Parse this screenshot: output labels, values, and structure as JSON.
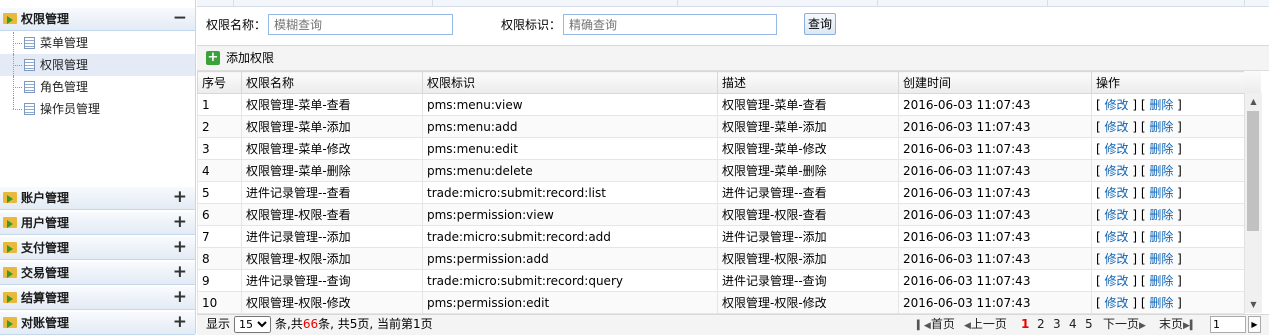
{
  "sidebar": {
    "sections": [
      {
        "label": "权限管理",
        "toggle": "−"
      },
      {
        "label": "账户管理",
        "toggle": "+"
      },
      {
        "label": "用户管理",
        "toggle": "+"
      },
      {
        "label": "支付管理",
        "toggle": "+"
      },
      {
        "label": "交易管理",
        "toggle": "+"
      },
      {
        "label": "结算管理",
        "toggle": "+"
      },
      {
        "label": "对账管理",
        "toggle": "+"
      }
    ],
    "tree_items": [
      {
        "label": "菜单管理",
        "selected": false
      },
      {
        "label": "权限管理",
        "selected": true
      },
      {
        "label": "角色管理",
        "selected": false
      },
      {
        "label": "操作员管理",
        "selected": false
      }
    ]
  },
  "search": {
    "name_label": "权限名称：",
    "name_placeholder": "模糊查询",
    "key_label": "权限标识：",
    "key_placeholder": "精确查询",
    "button": "查询"
  },
  "toolbar": {
    "add_label": "添加权限",
    "add_icon": "add-icon"
  },
  "grid": {
    "columns": [
      "序号",
      "权限名称",
      "权限标识",
      "描述",
      "创建时间",
      "操作"
    ],
    "rows": [
      [
        "1",
        "权限管理-菜单-查看",
        "pms:menu:view",
        "权限管理-菜单-查看",
        "2016-06-03 11:07:43"
      ],
      [
        "2",
        "权限管理-菜单-添加",
        "pms:menu:add",
        "权限管理-菜单-添加",
        "2016-06-03 11:07:43"
      ],
      [
        "3",
        "权限管理-菜单-修改",
        "pms:menu:edit",
        "权限管理-菜单-修改",
        "2016-06-03 11:07:43"
      ],
      [
        "4",
        "权限管理-菜单-删除",
        "pms:menu:delete",
        "权限管理-菜单-删除",
        "2016-06-03 11:07:43"
      ],
      [
        "5",
        "进件记录管理--查看",
        "trade:micro:submit:record:list",
        "进件记录管理--查看",
        "2016-06-03 11:07:43"
      ],
      [
        "6",
        "权限管理-权限-查看",
        "pms:permission:view",
        "权限管理-权限-查看",
        "2016-06-03 11:07:43"
      ],
      [
        "7",
        "进件记录管理--添加",
        "trade:micro:submit:record:add",
        "进件记录管理--添加",
        "2016-06-03 11:07:43"
      ],
      [
        "8",
        "权限管理-权限-添加",
        "pms:permission:add",
        "权限管理-权限-添加",
        "2016-06-03 11:07:43"
      ],
      [
        "9",
        "进件记录管理--查询",
        "trade:micro:submit:record:query",
        "进件记录管理--查询",
        "2016-06-03 11:07:43"
      ],
      [
        "10",
        "权限管理-权限-修改",
        "pms:permission:edit",
        "权限管理-权限-修改",
        "2016-06-03 11:07:43"
      ]
    ],
    "op_edit": "修改",
    "op_delete": "删除"
  },
  "pager": {
    "show_label": "显示",
    "page_size": "15",
    "info_a": "条,共",
    "total": "66",
    "info_b": "条, 共5页, 当前第1页",
    "first": "首页",
    "prev": "上一页",
    "pages": [
      "1",
      "2",
      "3",
      "4",
      "5"
    ],
    "current_page": "1",
    "next": "下一页",
    "last": "末页",
    "jump_value": "1"
  }
}
